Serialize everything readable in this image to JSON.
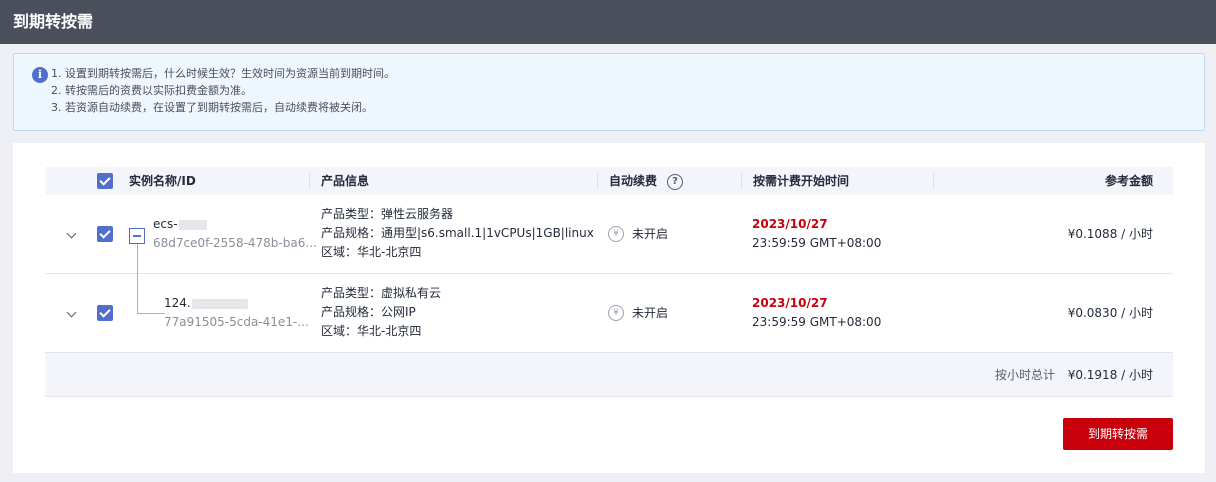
{
  "header": {
    "title": "到期转按需"
  },
  "notice": {
    "lines": [
      "1. 设置到期转按需后，什么时候生效？生效时间为资源当前到期时间。",
      "2. 转按需后的资费以实际扣费金额为准。",
      "3. 若资源自动续费，在设置了到期转按需后，自动续费将被关闭。"
    ]
  },
  "table": {
    "columns": {
      "name": "实例名称/ID",
      "product": "产品信息",
      "auto_renew": "自动续费",
      "start_time": "按需计费开始时间",
      "amount": "参考金额"
    },
    "rows": [
      {
        "name": "ecs-",
        "id": "68d7ce0f-2558-478b-ba6...",
        "type": "产品类型：弹性云服务器",
        "spec": "产品规格：通用型|s6.small.1|1vCPUs|1GB|linux",
        "region": "区域：华北-北京四",
        "renew": "未开启",
        "date": "2023/10/27",
        "time": "23:59:59 GMT+08:00",
        "amount": "¥0.1088 / 小时"
      },
      {
        "name": "124.",
        "id": "77a91505-5cda-41e1-...",
        "type": "产品类型：虚拟私有云",
        "spec": "产品规格：公网IP",
        "region": "区域：华北-北京四",
        "renew": "未开启",
        "date": "2023/10/27",
        "time": "23:59:59 GMT+08:00",
        "amount": "¥0.0830 / 小时"
      }
    ],
    "total_label": "按小时总计",
    "total_value": "¥0.1918 / 小时"
  },
  "actions": {
    "submit_label": "到期转按需"
  },
  "colors": {
    "accent": "#526ecc",
    "danger": "#c7000b",
    "header_bg": "#4a4f5c"
  }
}
